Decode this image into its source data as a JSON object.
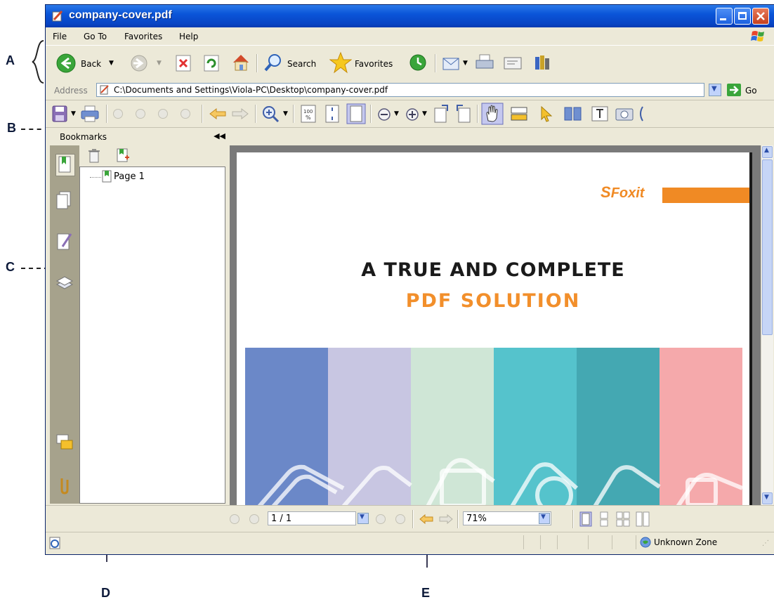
{
  "callouts": {
    "a": "A",
    "b": "B",
    "c": "C",
    "d": "D",
    "e": "E"
  },
  "window": {
    "title": "company-cover.pdf"
  },
  "menu": {
    "items": [
      "File",
      "Go To",
      "Favorites",
      "Help"
    ]
  },
  "toolbar": {
    "back_label": "Back",
    "search_label": "Search",
    "favorites_label": "Favorites"
  },
  "address": {
    "label": "Address",
    "value": "C:\\Documents and Settings\\Viola-PC\\Desktop\\company-cover.pdf",
    "go_label": "Go"
  },
  "bookmarks": {
    "title": "Bookmarks",
    "items": [
      {
        "label": "Page 1"
      }
    ]
  },
  "document": {
    "logo_text": "Foxit",
    "headline_line1": "A TRUE AND COMPLETE",
    "headline_line2": "PDF SOLUTION"
  },
  "navigation": {
    "page": "1 / 1",
    "zoom": "71%"
  },
  "status": {
    "zone": "Unknown Zone"
  },
  "colors": {
    "title_bar": "#0a55d9",
    "accent_orange": "#f08a24",
    "stripes": [
      "#6b88c8",
      "#c8c6e2",
      "#cfe6d6",
      "#55c3cc",
      "#44a8b2",
      "#f5a9ab"
    ]
  }
}
